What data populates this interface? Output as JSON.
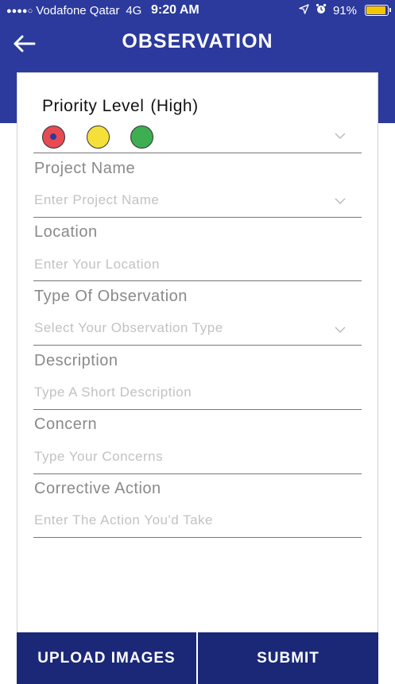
{
  "status_bar": {
    "signal_dots": "●●●●○",
    "carrier": "Vodafone Qatar",
    "network": "4G",
    "time": "9:20 AM",
    "battery_percent": "91%",
    "battery_level": 0.91,
    "icons": [
      "location-arrow-icon",
      "alarm-icon",
      "battery-icon"
    ]
  },
  "header": {
    "back_icon": "arrow-left-icon",
    "title": "OBSERVATION"
  },
  "colors": {
    "brand_blue": "#2b3a9c",
    "footer_blue": "#1b2878",
    "priority_red": "#e84a52",
    "priority_yellow": "#f5e03a",
    "priority_green": "#3dae52",
    "battery_yellow": "#f5c400"
  },
  "priority": {
    "label": "Priority Level",
    "value": "(High)",
    "options": [
      "red",
      "yellow",
      "green"
    ],
    "selected": "red"
  },
  "form": {
    "project_name": {
      "label": "Project Name",
      "placeholder": "Enter Project Name"
    },
    "location": {
      "label": "Location",
      "placeholder": "Enter Your Location"
    },
    "observation_type": {
      "label": "Type Of Observation",
      "placeholder": "Select Your Observation Type"
    },
    "description": {
      "label": "Description",
      "placeholder": "Type A Short Description"
    },
    "concern": {
      "label": "Concern",
      "placeholder": "Type Your Concerns"
    },
    "corrective_action": {
      "label": "Corrective Action",
      "placeholder": "Enter The Action You'd Take"
    }
  },
  "footer": {
    "upload_label": "UPLOAD IMAGES",
    "submit_label": "SUBMIT"
  }
}
